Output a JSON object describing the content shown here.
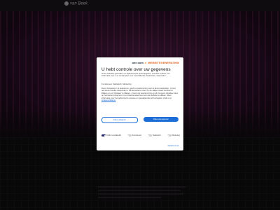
{
  "site": {
    "logo_text": "van Beek"
  },
  "consent": {
    "brand_one": "one.com",
    "brand_sep": "x",
    "brand_gen": "WEBSITEGENERATION",
    "title": "U hebt controle over uw gegevens",
    "body": "Onze websites gebruiken en bijbehorende technologieën, inclusief cookies, om informatie over u te verzamelen voor verschillende doeleinden, waaronder:",
    "purposes": "Functioneel, Statistisch, Marketing",
    "body2": "Door 'Accepteren' te selecteren, geeft u toestemming voor al deze doeleinden. U kunt ook kiezen welke doeleinden u wilt accepteren door op de vakjes naast het doel te klikken en op 'Opslaan' te klikken. U kunt uw toestemming op elk moment intrekken door op het kleine pictogram in de linkerbenedenhoek van de website te klikken. Meer informatie over het gebruik van cookies en gerelateerde technologieën vindt u op",
    "link_text": "cookieverklaring",
    "reject_label": "Alles afwijzen",
    "accept_label": "Alles accepteren",
    "toggles": [
      {
        "label": "Strikt noodzakelijk",
        "on": true
      },
      {
        "label": "Functioneel",
        "on": false
      },
      {
        "label": "Statistisch",
        "on": false
      },
      {
        "label": "Marketing",
        "on": false
      }
    ],
    "details_label": "Details tonen"
  }
}
